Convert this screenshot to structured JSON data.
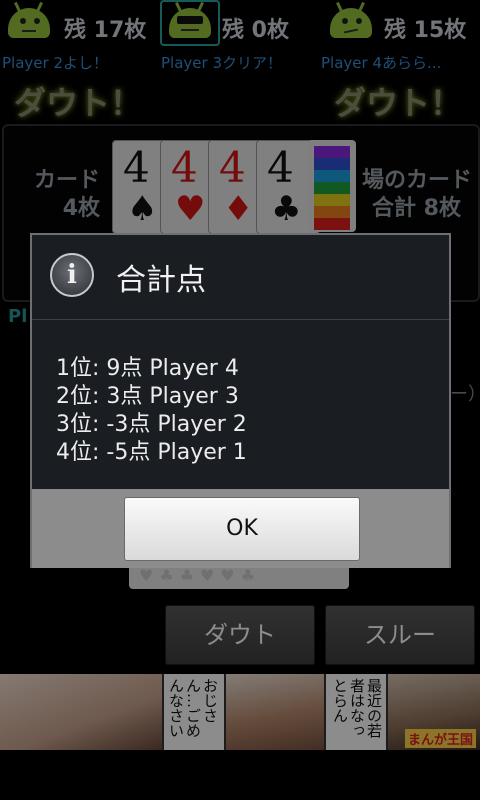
{
  "players_top": [
    {
      "count": "残 17枚",
      "message": "Player 2よし！",
      "doubt": "ダウト！"
    },
    {
      "count": "残  0枚",
      "message": "Player 3クリア！",
      "doubt": ""
    },
    {
      "count": "残 15枚",
      "message": "Player 4あらら...",
      "doubt": "ダウト！"
    }
  ],
  "field": {
    "cards_label": "カード",
    "cards_count": "4枚",
    "pile_label": "場のカード",
    "pile_total": "合計  8枚",
    "cards": [
      {
        "rank": "4",
        "suit": "♠",
        "color": "black"
      },
      {
        "rank": "4",
        "suit": "♥",
        "color": "red"
      },
      {
        "rank": "4",
        "suit": "♦",
        "color": "red"
      },
      {
        "rank": "4",
        "suit": "♣",
        "color": "black"
      }
    ],
    "deck_colors": [
      "#8a2be2",
      "#3050d8",
      "#1aa0e0",
      "#20a040",
      "#e8d020",
      "#f08020",
      "#e02020"
    ]
  },
  "partial_text": {
    "player_prefix": "Pl",
    "paren": "ー）"
  },
  "dialog": {
    "title": "合計点",
    "icon": "info-icon",
    "results": [
      "1位:  9点 Player 4",
      "2位:  3点 Player 3",
      "3位: -3点 Player 2",
      "4位: -5点 Player 1"
    ],
    "ok_label": "OK"
  },
  "hand": {
    "suits": "♥♣♣♥♥♣"
  },
  "actions": {
    "doubt_label": "ダウト",
    "through_label": "スルー"
  },
  "ad": {
    "text1": "おじさん…ごめんなさい",
    "text2": "最近の若者はなっとらん",
    "logo": "まんが王国"
  }
}
